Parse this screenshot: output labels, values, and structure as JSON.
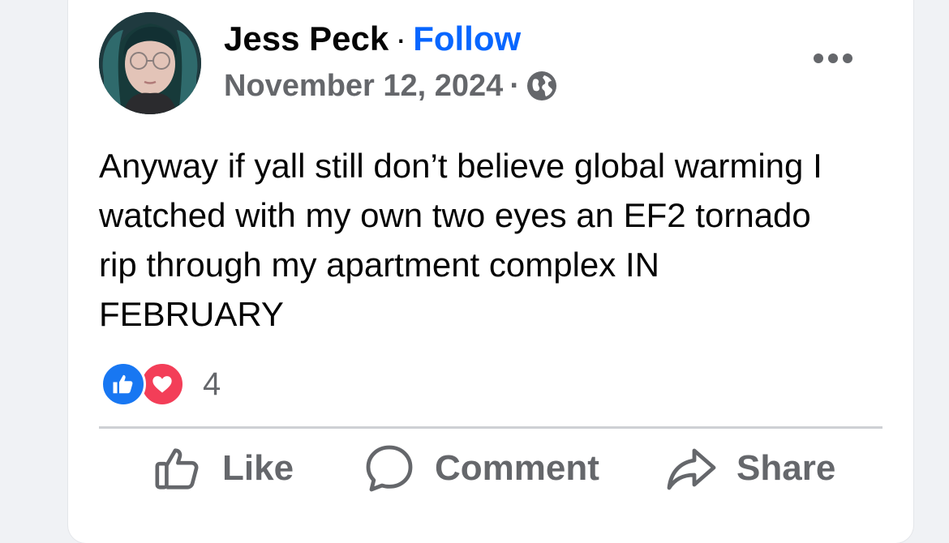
{
  "post": {
    "author": "Jess Peck",
    "separator": "·",
    "follow_label": "Follow",
    "date": "November 12, 2024",
    "audience_icon": "globe-icon",
    "more_icon": "more-horizontal-icon",
    "text": "Anyway if yall still don’t believe global warming I watched with my own two eyes an EF2 tornado rip through my apartment complex IN FEBRUARY"
  },
  "reactions": {
    "types": [
      "like",
      "love"
    ],
    "count": "4"
  },
  "actions": {
    "like_label": "Like",
    "comment_label": "Comment",
    "share_label": "Share"
  },
  "colors": {
    "link": "#0866ff",
    "secondary_text": "#65676b",
    "like_blue": "#1877f2",
    "love_red": "#f33e58",
    "divider": "#ced0d4"
  }
}
